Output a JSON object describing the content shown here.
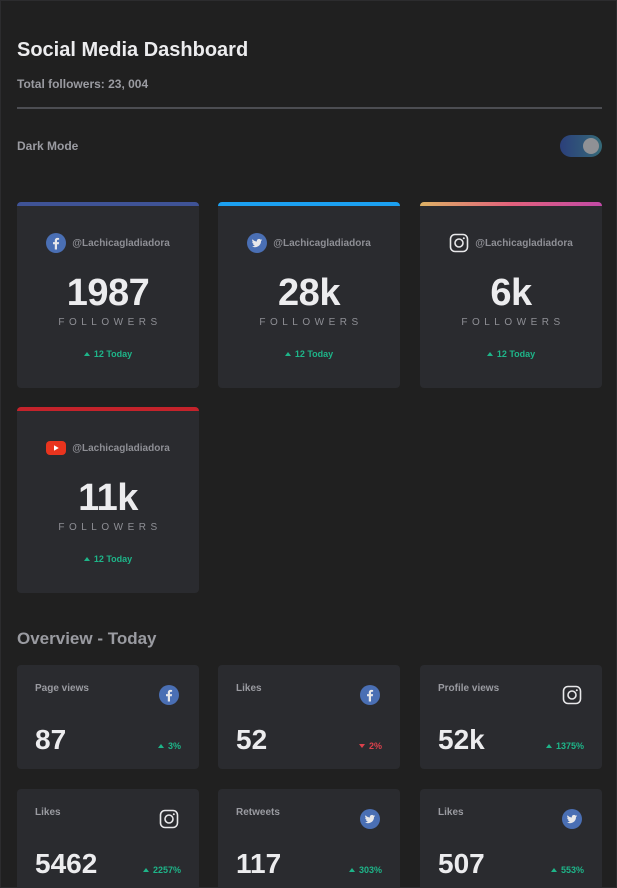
{
  "header": {
    "title": "Social Media Dashboard",
    "total_followers": "Total followers: 23, 004",
    "dark_mode_label": "Dark Mode",
    "dark_mode_on": true
  },
  "colors": {
    "background": "#202020",
    "card": "#2a2b2f",
    "up": "#1eb589",
    "down": "#dc414c",
    "facebook": "#4267b2",
    "twitter": "#1da1f2",
    "youtube": "#e9341e"
  },
  "cards": [
    {
      "icon": "facebook-icon",
      "handle": "@Lachicagladiadora",
      "count": "1987",
      "unit": "FOLLOWERS",
      "today": "12 Today",
      "trend": "up"
    },
    {
      "icon": "twitter-icon",
      "handle": "@Lachicagladiadora",
      "count": "28k",
      "unit": "FOLLOWERS",
      "today": "12 Today",
      "trend": "up"
    },
    {
      "icon": "instagram-icon",
      "handle": "@Lachicagladiadora",
      "count": "6k",
      "unit": "FOLLOWERS",
      "today": "12 Today",
      "trend": "up"
    },
    {
      "icon": "youtube-icon",
      "handle": "@Lachicagladiadora",
      "count": "11k",
      "unit": "FOLLOWERS",
      "today": "12 Today",
      "trend": "up"
    }
  ],
  "overview": {
    "title": "Overview - Today",
    "items": [
      {
        "label": "Page views",
        "icon": "facebook-icon",
        "value": "87",
        "change": "3%",
        "trend": "up"
      },
      {
        "label": "Likes",
        "icon": "facebook-icon",
        "value": "52",
        "change": "2%",
        "trend": "down"
      },
      {
        "label": "Profile views",
        "icon": "instagram-icon",
        "value": "52k",
        "change": "1375%",
        "trend": "up"
      },
      {
        "label": "Likes",
        "icon": "instagram-icon",
        "value": "5462",
        "change": "2257%",
        "trend": "up"
      },
      {
        "label": "Retweets",
        "icon": "twitter-icon",
        "value": "117",
        "change": "303%",
        "trend": "up"
      },
      {
        "label": "Likes",
        "icon": "twitter-icon",
        "value": "507",
        "change": "553%",
        "trend": "up"
      }
    ]
  }
}
